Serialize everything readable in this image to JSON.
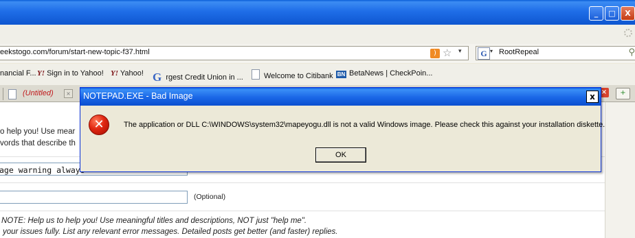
{
  "window": {
    "minimize_glyph": "_",
    "maximize_glyph": "□",
    "close_glyph": "X"
  },
  "nav": {
    "url": "eekstogo.com/forum/start-new-topic-f37.html",
    "search_value": "RootRepeal"
  },
  "bookmarks": [
    "nancial F...",
    "Sign in to Yahoo!",
    "Yahoo!",
    "rgest Credit Union in ...",
    "Welcome to Citibank",
    "BetaNews | CheckPoin..."
  ],
  "tabs": {
    "active_title": "(Untitled)"
  },
  "page": {
    "help_line1": "o help you! Use mear",
    "help_line2": "vords that describe th",
    "title_field_value": "age warning always",
    "optional_label": "(Optional)",
    "note_line1": "NOTE: Help us to help you! Use meaningful titles and descriptions, NOT just \"help me\".",
    "note_line2": "your issues fully. List any relevant error messages. Detailed posts get better (and faster) replies."
  },
  "dialog": {
    "title": "NOTEPAD.EXE - Bad Image",
    "message": "The application or DLL C:\\WINDOWS\\system32\\mapeyogu.dll is not a valid Windows image. Please check this against your installation diskette.",
    "ok_label": "OK",
    "close_glyph": "x",
    "icon": "error-icon"
  },
  "colors": {
    "titlebar_blue": "#1f6ee8",
    "dialog_face": "#ece9d8",
    "error_red": "#e02610",
    "untitled_tab_red": "#c0181b"
  }
}
